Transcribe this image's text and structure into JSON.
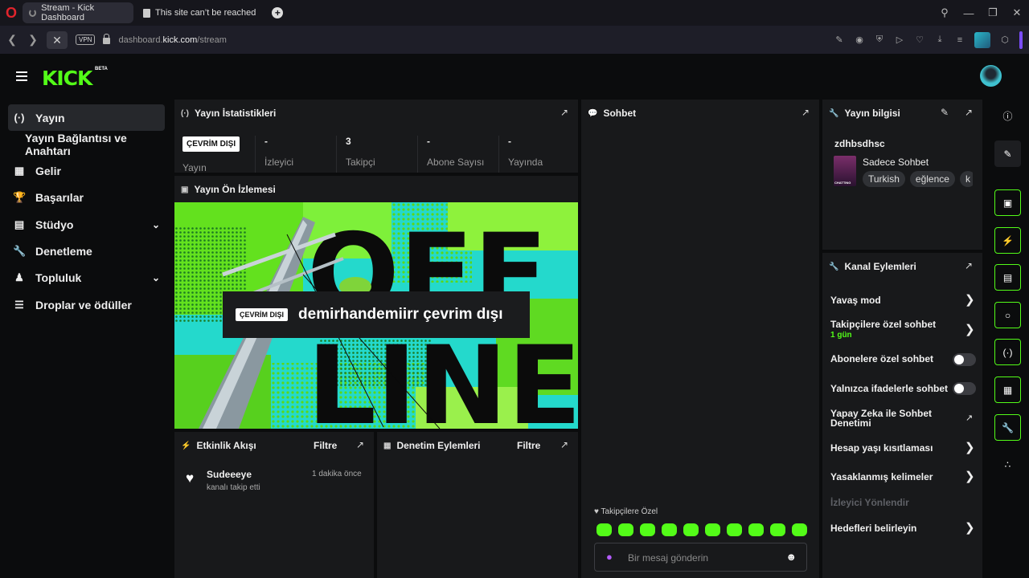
{
  "browser": {
    "tabs": [
      {
        "title": "Stream - Kick Dashboard",
        "active": true
      },
      {
        "title": "This site can’t be reached",
        "active": false
      }
    ],
    "url_prefix": "dashboard.",
    "url_domain": "kick.com",
    "url_path": "/stream",
    "vpn_label": "VPN"
  },
  "header": {
    "logo": "KICK",
    "logo_badge": "BETA"
  },
  "sidebar": {
    "items": [
      {
        "label": "Yayın",
        "icon": "broadcast-icon",
        "active": true
      },
      {
        "label": "Yayın Bağlantısı ve Anahtarı",
        "icon": "",
        "active": false
      },
      {
        "label": "Gelir",
        "icon": "revenue-icon"
      },
      {
        "label": "Başarılar",
        "icon": "trophy-icon"
      },
      {
        "label": "Stüdyo",
        "icon": "studio-icon",
        "expandable": true
      },
      {
        "label": "Denetleme",
        "icon": "wrench-icon"
      },
      {
        "label": "Topluluk",
        "icon": "community-icon",
        "expandable": true
      },
      {
        "label": "Droplar ve ödüller",
        "icon": "drops-icon"
      }
    ]
  },
  "stats": {
    "title": "Yayın İstatistikleri",
    "status_badge": "ÇEVRİM DIŞI",
    "status_label": "Yayın",
    "items": [
      {
        "value": "-",
        "label": "İzleyici"
      },
      {
        "value": "3",
        "label": "Takipçi"
      },
      {
        "value": "-",
        "label": "Abone Sayısı"
      },
      {
        "value": "-",
        "label": "Yayında"
      }
    ]
  },
  "preview": {
    "title": "Yayın Ön İzlemesi",
    "badge": "ÇEVRİM DIŞI",
    "offline_text": "demirhandemiirr çevrim dışı",
    "art_text_top": "OFF",
    "art_text_bottom": "LINE"
  },
  "activity": {
    "title": "Etkinlik Akışı",
    "filter": "Filtre",
    "events": [
      {
        "user": "Sudeeeye",
        "action": "kanalı takip etti",
        "time": "1 dakika önce"
      }
    ]
  },
  "moderation": {
    "title": "Denetim Eylemleri",
    "filter": "Filtre"
  },
  "chat": {
    "title": "Sohbet",
    "followers_only_label": "Takipçilere Özel",
    "input_placeholder": "Bir mesaj gönderin",
    "emote_count": 10
  },
  "stream_info": {
    "title": "Yayın bilgisi",
    "username": "zdhbsdhsc",
    "stream_title": "Sadece Sohbet",
    "tags": [
      "Turkish",
      "eğlence",
      "k"
    ],
    "thumb_caption": "CHATTING"
  },
  "channel_actions": {
    "title": "Kanal Eylemleri",
    "items": [
      {
        "label": "Yavaş mod",
        "control": "chevron"
      },
      {
        "label": "Takipçilere özel sohbet",
        "sub": "1 gün",
        "control": "chevron"
      },
      {
        "label": "Abonelere özel sohbet",
        "control": "toggle"
      },
      {
        "label": "Yalnızca ifadelerle sohbet",
        "control": "toggle"
      },
      {
        "label": "Yapay Zeka ile Sohbet Denetimi",
        "control": "external"
      },
      {
        "label": "Hesap yaşı kısıtlaması",
        "control": "chevron"
      },
      {
        "label": "Yasaklanmış kelimeler",
        "control": "chevron"
      },
      {
        "label": "İzleyici Yönlendir",
        "control": "none",
        "disabled": true
      },
      {
        "label": "Hedefleri belirleyin",
        "control": "chevron"
      }
    ]
  },
  "colors": {
    "accent": "#53fc18",
    "panel": "#18191b",
    "background": "#0b0c0d"
  }
}
